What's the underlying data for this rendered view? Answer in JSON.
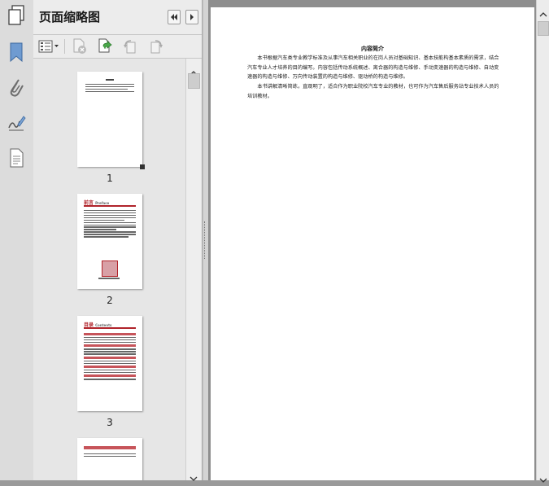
{
  "panel": {
    "title": "页面缩略图"
  },
  "thumbnails": [
    {
      "label": "1"
    },
    {
      "label": "2",
      "heading": "前言",
      "subheading": "Preface"
    },
    {
      "label": "3",
      "heading": "目录",
      "subheading": "Contents"
    },
    {
      "label": ""
    }
  ],
  "document": {
    "title": "内容简介",
    "paragraphs": [
      "本书根据汽车类专业教学标准及从事汽车相关职业的在岗人员对基础知识、基本技能构基本素质的需求，结合汽车专业人才培养的目的编写。内容包括传动系统概述、离合器的构造与维修、手动变速器的构造与维修、自动变速器的构造与维修、万向传动装置的构造与维修、驱动桥的构造与维修。",
      "本书讲解清晰简练，直观明了，适合作为职业院校汽车专业的教材，也可作为汽车售后服务站专业技术人员的培训教材。"
    ]
  },
  "colors": {
    "accent_red": "#b0232a",
    "icon_blue": "#5a86b8"
  }
}
